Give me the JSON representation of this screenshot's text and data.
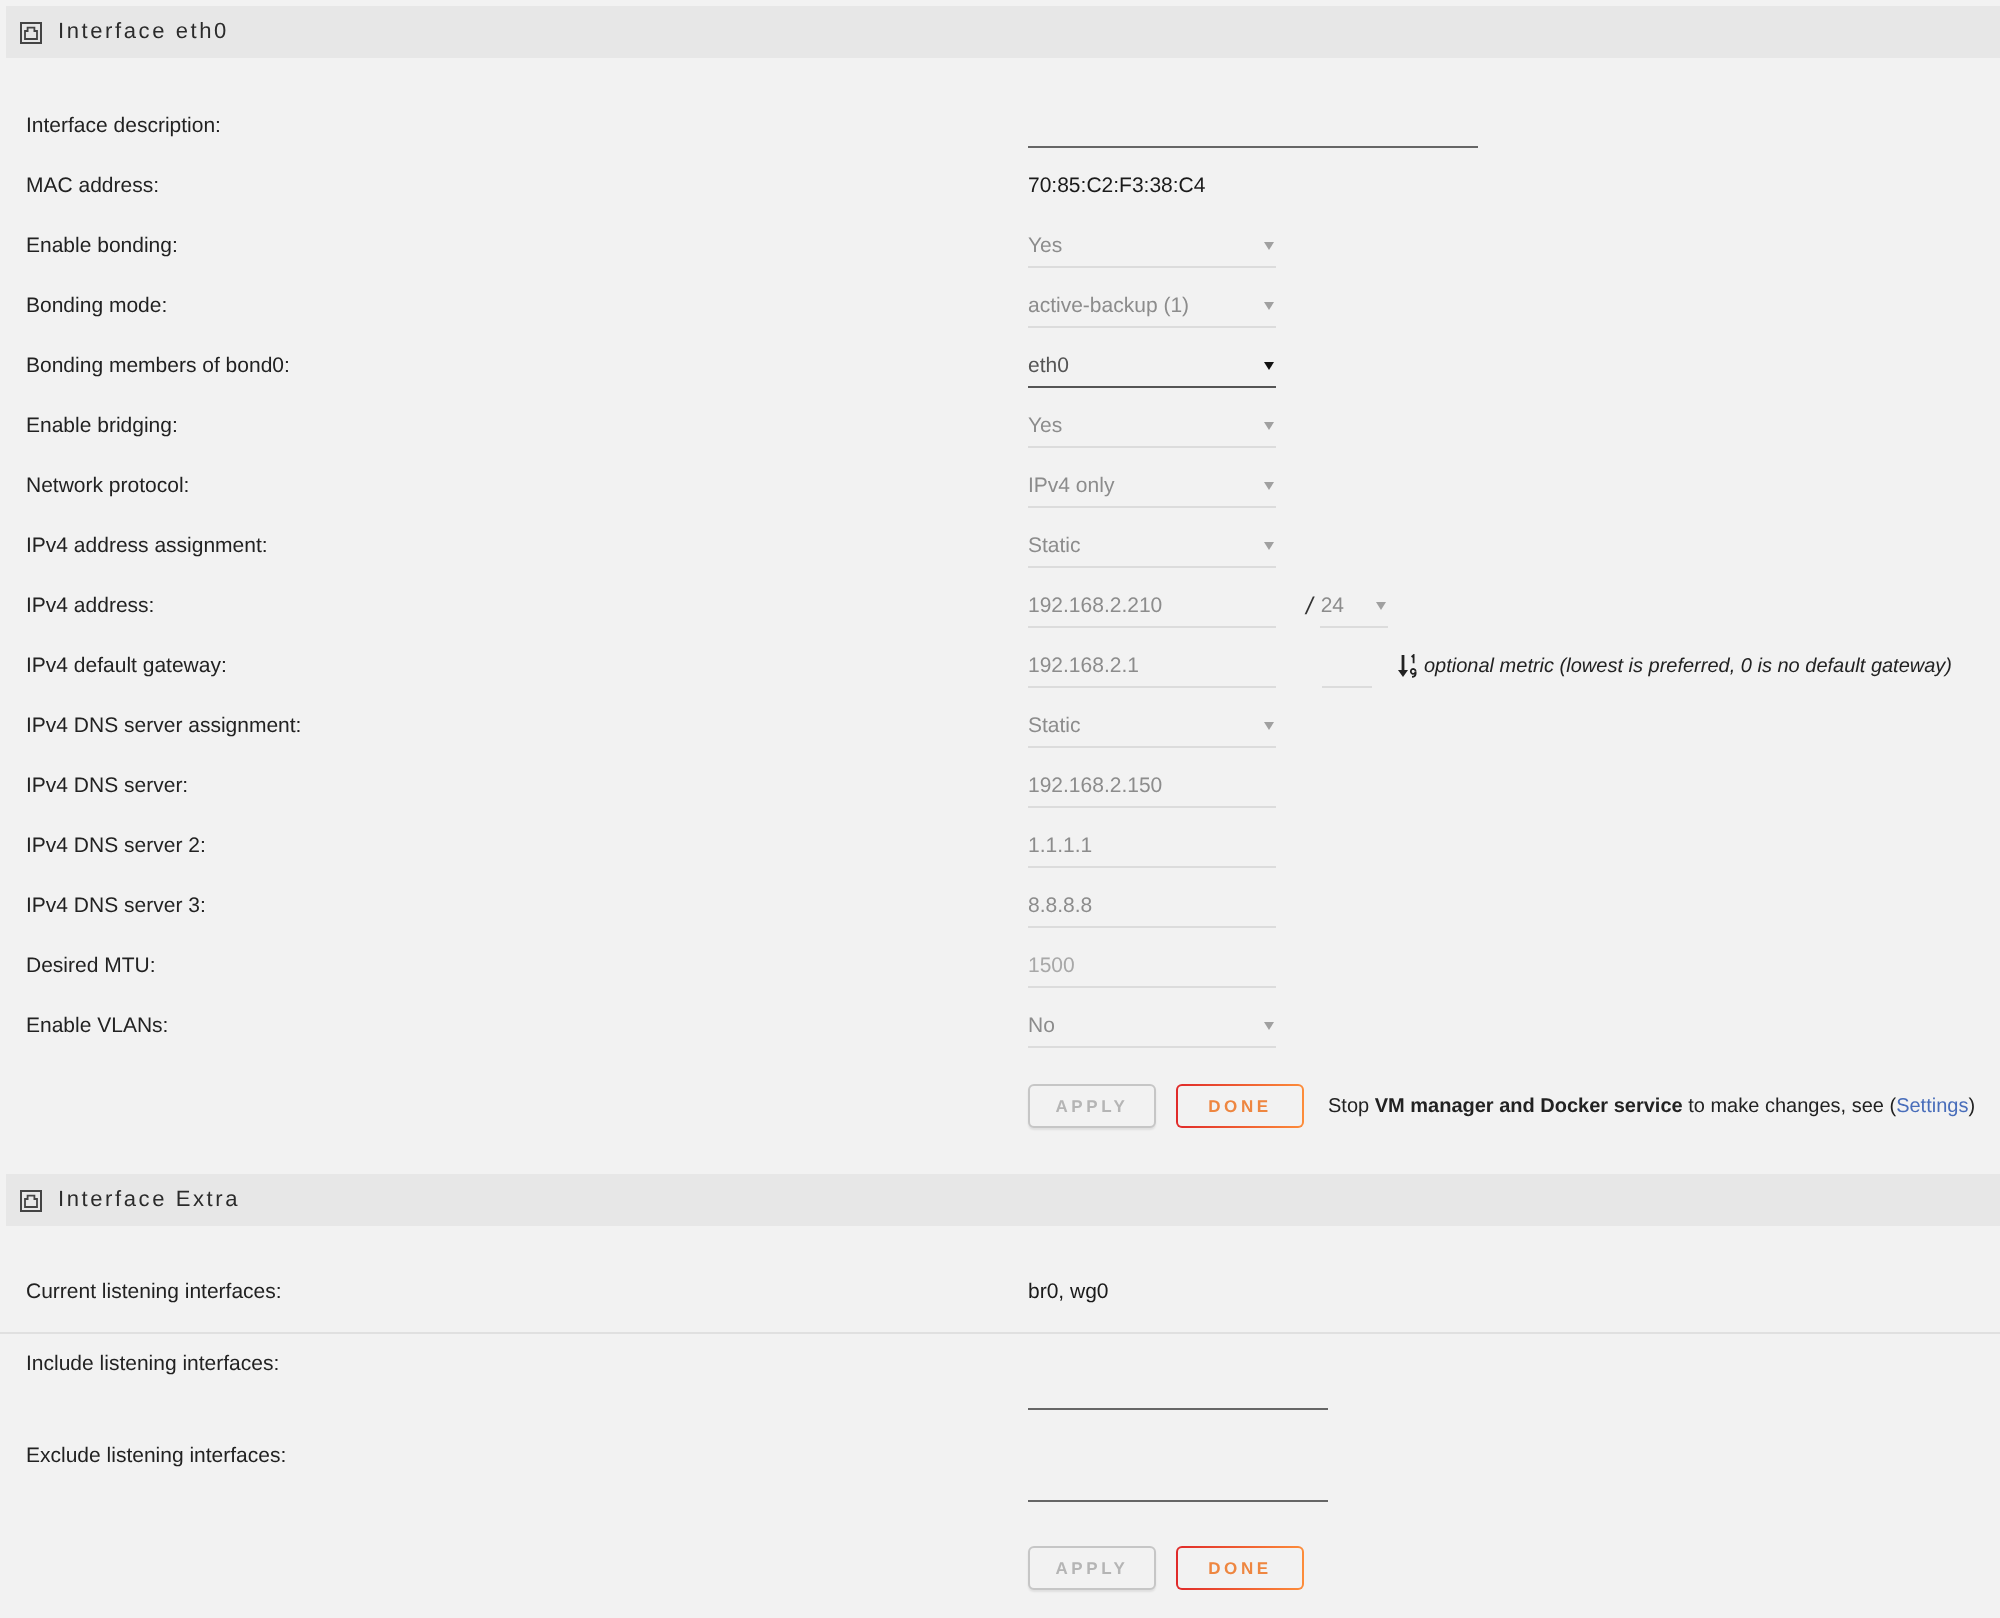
{
  "sections": [
    {
      "title": "Interface eth0",
      "rows": [
        {
          "label": "Interface description:",
          "kind": "text",
          "disabled": false
        },
        {
          "label": "MAC address:",
          "kind": "value",
          "value": "70:85:C2:F3:38:C4"
        },
        {
          "label": "Enable bonding:",
          "kind": "select",
          "value": "Yes",
          "disabled": true
        },
        {
          "label": "Bonding mode:",
          "kind": "select",
          "value": "active-backup (1)",
          "disabled": true
        },
        {
          "label": "Bonding members of bond0:",
          "kind": "select",
          "value": "eth0",
          "disabled": false
        },
        {
          "label": "Enable bridging:",
          "kind": "select",
          "value": "Yes",
          "disabled": true
        },
        {
          "label": "Network protocol:",
          "kind": "select",
          "value": "IPv4 only",
          "disabled": true
        },
        {
          "label": "IPv4 address assignment:",
          "kind": "select",
          "value": "Static",
          "disabled": true
        },
        {
          "label": "IPv4 address:",
          "kind": "input",
          "value": "192.168.2.210",
          "disabled": true,
          "prefix": {
            "separator": "/",
            "value": "24",
            "disabled": true
          }
        },
        {
          "label": "IPv4 default gateway:",
          "kind": "input",
          "value": "192.168.2.1",
          "disabled": true,
          "metric": {
            "disabled": true,
            "hint": "optional metric (lowest is preferred, 0 is no default gateway)"
          }
        },
        {
          "label": "IPv4 DNS server assignment:",
          "kind": "select",
          "value": "Static",
          "disabled": true
        },
        {
          "label": "IPv4 DNS server:",
          "kind": "input",
          "value": "192.168.2.150",
          "disabled": true
        },
        {
          "label": "IPv4 DNS server 2:",
          "kind": "input",
          "value": "1.1.1.1",
          "disabled": true
        },
        {
          "label": "IPv4 DNS server 3:",
          "kind": "input",
          "value": "8.8.8.8",
          "disabled": true
        },
        {
          "label": "Desired MTU:",
          "kind": "input",
          "placeholder": "1500",
          "disabled": true
        },
        {
          "label": "Enable VLANs:",
          "kind": "select",
          "value": "No",
          "disabled": true
        }
      ],
      "buttons": [
        {
          "label": "APPLY",
          "disabled": true
        },
        {
          "label": "DONE",
          "disabled": false
        }
      ],
      "note": {
        "text": "Stop **VM manager and Docker service** to make changes, see (",
        "link": "Settings",
        "text_end": ")"
      }
    },
    {
      "title": "Interface Extra",
      "rows": [
        {
          "label": "Current listening interfaces:",
          "kind": "value",
          "value": "br0, wg0",
          "divider": true
        },
        {
          "label": "Include listening interfaces:",
          "kind": "text",
          "disabled": false
        },
        {
          "label": "Exclude listening interfaces:",
          "kind": "text",
          "disabled": false
        }
      ],
      "buttons": [
        {
          "label": "APPLY",
          "disabled": true
        },
        {
          "label": "DONE",
          "disabled": false
        }
      ]
    }
  ]
}
